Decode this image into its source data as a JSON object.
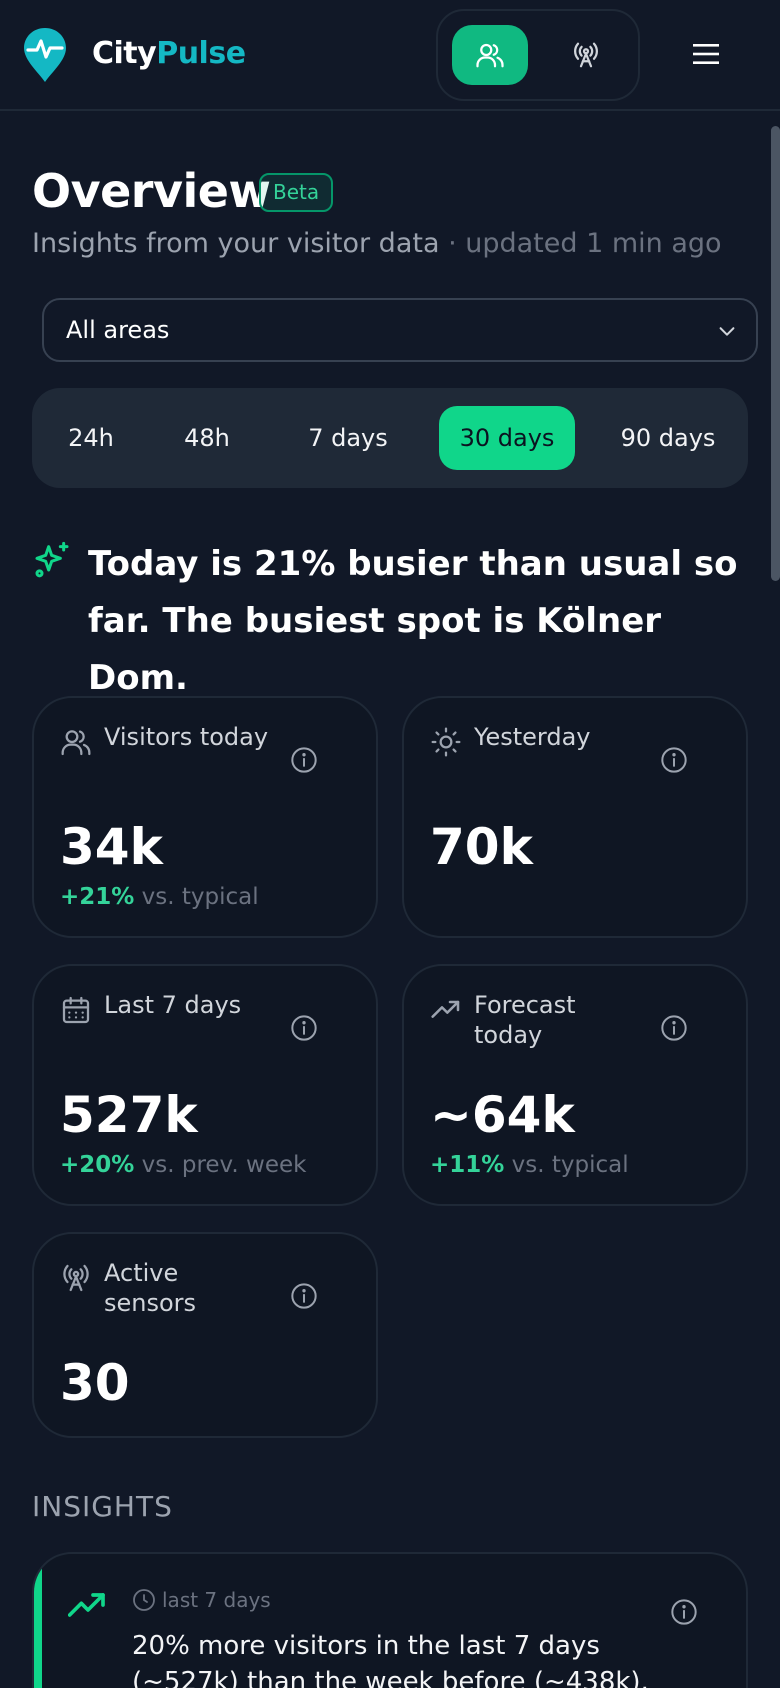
{
  "app": {
    "brand_part1": "City",
    "brand_part2": "Pulse",
    "accent_color": "#10b981",
    "brand_color": "#14b8c4"
  },
  "header": {
    "mode_buttons": [
      {
        "icon": "people-icon",
        "active": true
      },
      {
        "icon": "antenna-icon",
        "active": false
      }
    ],
    "menu_icon": "menu-icon"
  },
  "page": {
    "title": "Overview",
    "badge": "Beta",
    "subtitle_main": "Insights from your visitor data",
    "subtitle_sep": " · ",
    "subtitle_updated": "updated 1 min ago"
  },
  "area_select": {
    "value": "All areas"
  },
  "range_tabs": [
    {
      "label": "24h",
      "active": false
    },
    {
      "label": "48h",
      "active": false
    },
    {
      "label": "7 days",
      "active": false
    },
    {
      "label": "30 days",
      "active": true
    },
    {
      "label": "90 days",
      "active": false
    }
  ],
  "highlight": {
    "text": "Today is 21% busier than usual so far. The busiest spot is Kölner Dom."
  },
  "kpis": [
    {
      "label": "Visitors today",
      "icon": "people-icon",
      "value": "34k",
      "delta": "+21%",
      "delta_text": " vs. typical"
    },
    {
      "label": "Yesterday",
      "icon": "sun-icon",
      "value": "70k",
      "delta": "",
      "delta_text": ""
    },
    {
      "label": "Last 7 days",
      "icon": "calendar-icon",
      "value": "527k",
      "delta": "+20%",
      "delta_text": " vs. prev. week"
    },
    {
      "label": "Forecast today",
      "icon": "trend-up-icon",
      "value": "~64k",
      "delta": "+11%",
      "delta_text": " vs. typical"
    },
    {
      "label": "Active sensors",
      "icon": "antenna-icon",
      "value": "30",
      "delta": "",
      "delta_text": ""
    }
  ],
  "insights": {
    "heading": "INSIGHTS",
    "items": [
      {
        "period": "last 7 days",
        "text": "20% more visitors in the last 7 days (~527k) than the week before (~438k)."
      }
    ]
  }
}
